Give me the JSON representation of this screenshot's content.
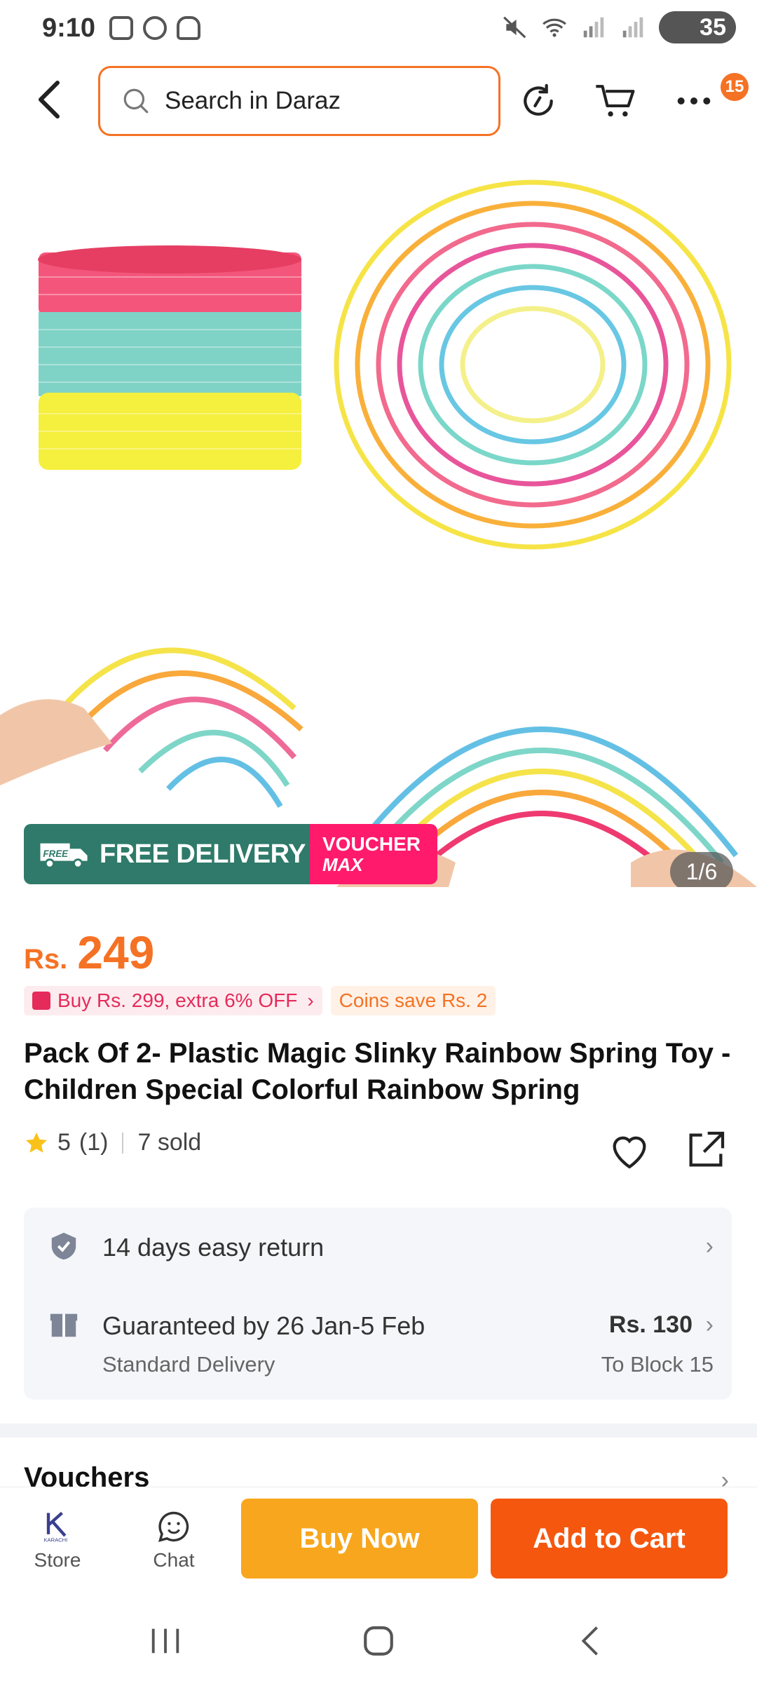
{
  "status_bar": {
    "time": "9:10",
    "battery": "35"
  },
  "header": {
    "search_placeholder": "Search in Daraz",
    "cart_badge": "15"
  },
  "gallery": {
    "page_indicator": "1/6",
    "free_delivery_label": "FREE DELIVERY",
    "free_truck_label": "FREE",
    "voucher_label": "VOUCHER",
    "voucher_sub": "MAX"
  },
  "price": {
    "currency": "Rs.",
    "value": "249"
  },
  "promos": {
    "buy_offer": "Buy Rs. 299, extra 6% OFF",
    "coins": "Coins save Rs. 2"
  },
  "product": {
    "title": "Pack Of 2- Plastic Magic Slinky Rainbow Spring Toy - Children Special Colorful Rainbow Spring",
    "rating": "5",
    "rating_count": "(1)",
    "sold": "7 sold"
  },
  "service": {
    "return_label": "14 days easy return",
    "guarantee_label": "Guaranteed by 26 Jan-5 Feb",
    "delivery_type": "Standard Delivery",
    "delivery_fee": "Rs. 130",
    "delivery_to": "To Block 15"
  },
  "vouchers": {
    "title": "Vouchers"
  },
  "action_bar": {
    "store_label": "Store",
    "store_logo_text": "KARACHI",
    "chat_label": "Chat",
    "buy_now_label": "Buy Now",
    "add_to_cart_label": "Add to Cart"
  },
  "colors": {
    "accent": "#f57224",
    "buy_now": "#f8a61d",
    "add_to_cart": "#f5570f",
    "free_delivery": "#2f7a6a",
    "voucher": "#ff1a6c"
  }
}
